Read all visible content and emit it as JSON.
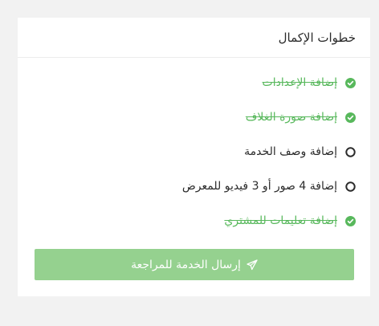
{
  "panel": {
    "title": "خطوات الإكمال"
  },
  "steps": [
    {
      "label": "إضافة الإعدادات",
      "status": "done"
    },
    {
      "label": "إضافة صورة الغلاف",
      "status": "done"
    },
    {
      "label": "إضافة وصف الخدمة",
      "status": "todo"
    },
    {
      "label": "إضافة 4 صور أو 3 فيديو للمعرض",
      "status": "todo"
    },
    {
      "label": "إضافة تعليمات للمشتري",
      "status": "done"
    }
  ],
  "submit": {
    "label": "إرسال الخدمة للمراجعة",
    "icon": "paper-plane-icon"
  },
  "colors": {
    "done": "#58b85c",
    "todo": "#2b2b2b",
    "button_bg": "#95d18f"
  }
}
